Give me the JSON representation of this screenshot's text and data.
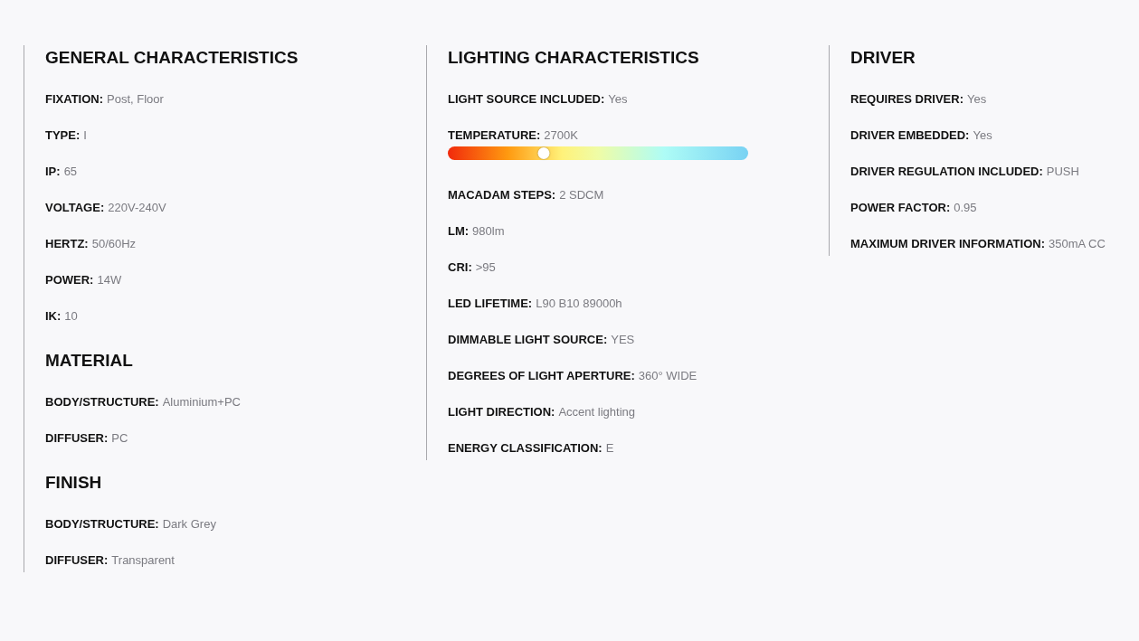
{
  "columns": [
    {
      "sections": [
        {
          "title": "GENERAL CHARACTERISTICS",
          "specs": [
            {
              "kind": "text",
              "label": "FIXATION:",
              "value": "Post, Floor"
            },
            {
              "kind": "text",
              "label": "TYPE:",
              "value": "I"
            },
            {
              "kind": "text",
              "label": "IP:",
              "value": "65"
            },
            {
              "kind": "text",
              "label": "VOLTAGE:",
              "value": "220V-240V"
            },
            {
              "kind": "text",
              "label": "HERTZ:",
              "value": "50/60Hz"
            },
            {
              "kind": "text",
              "label": "POWER:",
              "value": "14W"
            },
            {
              "kind": "text",
              "label": "IK:",
              "value": "10"
            }
          ]
        },
        {
          "title": "MATERIAL",
          "specs": [
            {
              "kind": "text",
              "label": "BODY/STRUCTURE:",
              "value": "Aluminium+PC"
            },
            {
              "kind": "text",
              "label": "DIFFUSER:",
              "value": "PC"
            }
          ]
        },
        {
          "title": "FINISH",
          "specs": [
            {
              "kind": "text",
              "label": "BODY/STRUCTURE:",
              "value": "Dark Grey"
            },
            {
              "kind": "text",
              "label": "DIFFUSER:",
              "value": "Transparent"
            }
          ]
        }
      ]
    },
    {
      "sections": [
        {
          "title": "LIGHTING CHARACTERISTICS",
          "specs": [
            {
              "kind": "text",
              "label": "LIGHT SOURCE INCLUDED:",
              "value": "Yes"
            },
            {
              "kind": "slider",
              "label": "TEMPERATURE:",
              "value": "2700K",
              "level": 0.32
            },
            {
              "kind": "text",
              "label": "MACADAM STEPS:",
              "value": "2 SDCM"
            },
            {
              "kind": "text",
              "label": "LM:",
              "value": "980lm"
            },
            {
              "kind": "text",
              "label": "CRI:",
              "value": ">95"
            },
            {
              "kind": "text",
              "label": "LED LIFETIME:",
              "value": "L90 B10 89000h"
            },
            {
              "kind": "text",
              "label": "DIMMABLE LIGHT SOURCE:",
              "value": "YES"
            },
            {
              "kind": "text",
              "label": "DEGREES OF LIGHT APERTURE:",
              "value": "360° WIDE"
            },
            {
              "kind": "text",
              "label": "LIGHT DIRECTION:",
              "value": "Accent lighting"
            },
            {
              "kind": "text",
              "label": "ENERGY CLASSIFICATION:",
              "value": "E"
            }
          ]
        }
      ]
    },
    {
      "sections": [
        {
          "title": "DRIVER",
          "specs": [
            {
              "kind": "text",
              "label": "REQUIRES DRIVER:",
              "value": "Yes"
            },
            {
              "kind": "text",
              "label": "DRIVER EMBEDDED:",
              "value": "Yes"
            },
            {
              "kind": "text",
              "label": "DRIVER REGULATION INCLUDED:",
              "value": "PUSH"
            },
            {
              "kind": "text",
              "label": "POWER FACTOR:",
              "value": "0.95"
            },
            {
              "kind": "text",
              "label": "MAXIMUM DRIVER INFORMATION:",
              "value": "350mA CC"
            }
          ]
        }
      ]
    }
  ]
}
